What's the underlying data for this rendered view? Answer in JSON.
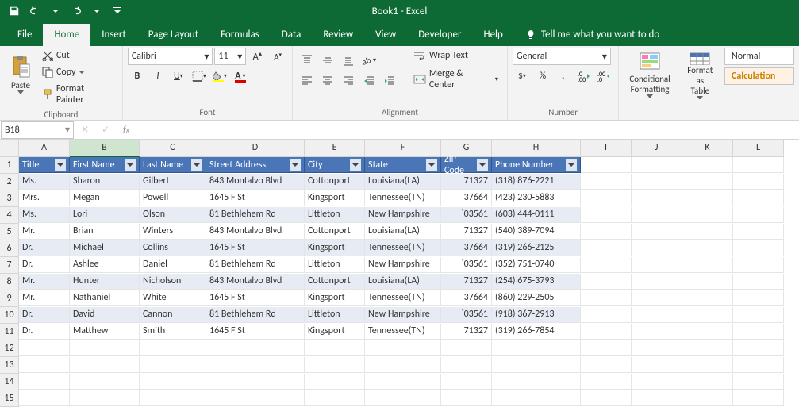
{
  "title": "Book1 - Excel",
  "tabs": [
    "File",
    "Home",
    "Insert",
    "Page Layout",
    "Formulas",
    "Data",
    "Review",
    "View",
    "Developer",
    "Help"
  ],
  "active_tab": 1,
  "tellme": "Tell me what you want to do",
  "clipboard": {
    "cut": "Cut",
    "copy": "Copy",
    "fmtpaint": "Format Painter",
    "paste": "Paste",
    "label": "Clipboard"
  },
  "font": {
    "name": "Calibri",
    "size": "11",
    "label": "Font"
  },
  "alignment": {
    "wrap": "Wrap Text",
    "merge": "Merge & Center",
    "label": "Alignment"
  },
  "number": {
    "format": "General",
    "label": "Number"
  },
  "styles": {
    "cond": "Conditional\nFormatting",
    "table": "Format as\nTable",
    "normal": "Normal",
    "calc": "Calculation"
  },
  "namebox": "B18",
  "cols": [
    "A",
    "B",
    "C",
    "D",
    "E",
    "F",
    "G",
    "H",
    "I",
    "J",
    "K",
    "L"
  ],
  "headers": [
    "Title",
    "First Name",
    "Last Name",
    "Street Address",
    "City",
    "State",
    "ZIP Code",
    "Phone Number"
  ],
  "rows": [
    {
      "n": 2,
      "d": [
        "Ms.",
        "Sharon",
        "Gilbert",
        "843 Montalvo Blvd",
        "Cottonport",
        "Louisiana(LA)",
        "71327",
        "(318) 876-2221"
      ]
    },
    {
      "n": 3,
      "d": [
        "Mrs.",
        "Megan",
        "Powell",
        "1645 F St",
        "Kingsport",
        "Tennessee(TN)",
        "37664",
        "(423) 230-5883"
      ]
    },
    {
      "n": 4,
      "d": [
        "Ms.",
        "Lori",
        "Olson",
        "81 Bethlehem Rd",
        "Littleton",
        "New Hampshire",
        "`03561",
        "(603) 444-0111"
      ]
    },
    {
      "n": 5,
      "d": [
        "Mr.",
        "Brian",
        "Winters",
        "843 Montalvo Blvd",
        "Cottonport",
        "Louisiana(LA)",
        "71327",
        "(540) 389-7094"
      ]
    },
    {
      "n": 6,
      "d": [
        "Dr.",
        "Michael",
        "Collins",
        "1645 F St",
        "Kingsport",
        "Tennessee(TN)",
        "37664",
        "(319) 266-2125"
      ]
    },
    {
      "n": 7,
      "d": [
        "Dr.",
        "Ashlee",
        "Daniel",
        "81 Bethlehem Rd",
        "Littleton",
        "New Hampshire",
        "`03561",
        "(352) 751-0740"
      ]
    },
    {
      "n": 8,
      "d": [
        "Mr.",
        "Hunter",
        "Nicholson",
        "843 Montalvo Blvd",
        "Cottonport",
        "Louisiana(LA)",
        "71327",
        "(254) 675-3793"
      ]
    },
    {
      "n": 9,
      "d": [
        "Mr.",
        "Nathaniel",
        "White",
        "1645 F St",
        "Kingsport",
        "Tennessee(TN)",
        "37664",
        "(860) 229-2505"
      ]
    },
    {
      "n": 10,
      "d": [
        "Dr.",
        "David",
        "Cannon",
        "81 Bethlehem Rd",
        "Littleton",
        "New Hampshire",
        "`03561",
        "(918) 367-2913"
      ]
    },
    {
      "n": 11,
      "d": [
        "Dr.",
        "Matthew",
        "Smith",
        "1645 F St",
        "Kingsport",
        "Tennessee(TN)",
        "",
        "71327",
        "(319) 266-7854"
      ]
    }
  ],
  "chart_data": {
    "type": "table",
    "columns": [
      "Title",
      "First Name",
      "Last Name",
      "Street Address",
      "City",
      "State",
      "ZIP Code",
      "Phone Number"
    ],
    "rows": [
      [
        "Ms.",
        "Sharon",
        "Gilbert",
        "843 Montalvo Blvd",
        "Cottonport",
        "Louisiana(LA)",
        "71327",
        "(318) 876-2221"
      ],
      [
        "Mrs.",
        "Megan",
        "Powell",
        "1645 F St",
        "Kingsport",
        "Tennessee(TN)",
        "37664",
        "(423) 230-5883"
      ],
      [
        "Ms.",
        "Lori",
        "Olson",
        "81 Bethlehem Rd",
        "Littleton",
        "New Hampshire",
        "`03561",
        "(603) 444-0111"
      ],
      [
        "Mr.",
        "Brian",
        "Winters",
        "843 Montalvo Blvd",
        "Cottonport",
        "Louisiana(LA)",
        "71327",
        "(540) 389-7094"
      ],
      [
        "Dr.",
        "Michael",
        "Collins",
        "1645 F St",
        "Kingsport",
        "Tennessee(TN)",
        "37664",
        "(319) 266-2125"
      ],
      [
        "Dr.",
        "Ashlee",
        "Daniel",
        "81 Bethlehem Rd",
        "Littleton",
        "New Hampshire",
        "`03561",
        "(352) 751-0740"
      ],
      [
        "Mr.",
        "Hunter",
        "Nicholson",
        "843 Montalvo Blvd",
        "Cottonport",
        "Louisiana(LA)",
        "71327",
        "(254) 675-3793"
      ],
      [
        "Mr.",
        "Nathaniel",
        "White",
        "1645 F St",
        "Kingsport",
        "Tennessee(TN)",
        "37664",
        "(860) 229-2505"
      ],
      [
        "Dr.",
        "David",
        "Cannon",
        "81 Bethlehem Rd",
        "Littleton",
        "New Hampshire",
        "`03561",
        "(918) 367-2913"
      ],
      [
        "Dr.",
        "Matthew",
        "Smith",
        "1645 F St",
        "Kingsport",
        "Tennessee(TN)",
        "71327",
        "(319) 266-7854"
      ]
    ]
  }
}
